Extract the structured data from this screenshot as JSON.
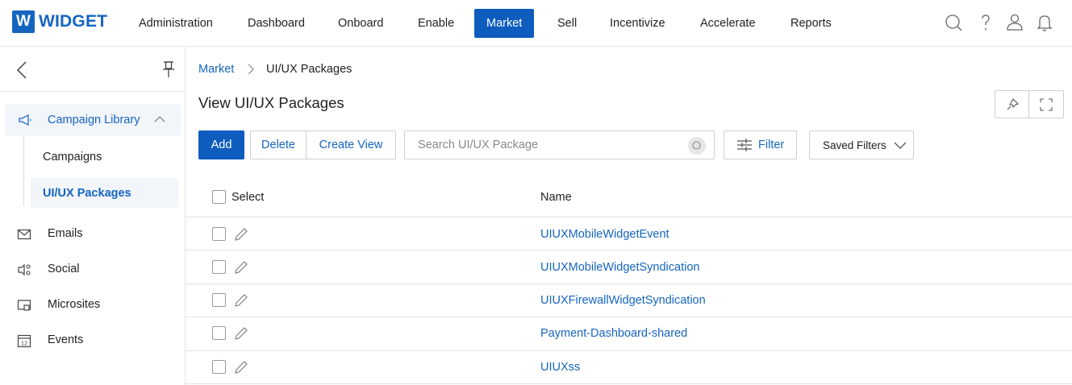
{
  "app": {
    "logo_letter": "W",
    "logo_name": "WIDGET",
    "brand_color": "#0d5cbe"
  },
  "nav": {
    "items": [
      "Administration",
      "Dashboard",
      "Onboard",
      "Enable",
      "Market",
      "Sell",
      "Incentivize",
      "Accelerate",
      "Reports"
    ],
    "active": "Market",
    "icons": [
      "search-icon",
      "help-icon",
      "user-icon",
      "bell-icon"
    ]
  },
  "sidebar": {
    "group": {
      "label": "Campaign Library",
      "expanded": true
    },
    "sub_items": [
      "Campaigns",
      "UI/UX Packages"
    ],
    "active_sub": "UI/UX Packages",
    "items": [
      {
        "label": "Emails",
        "icon": "mail-icon"
      },
      {
        "label": "Social",
        "icon": "social-icon"
      },
      {
        "label": "Microsites",
        "icon": "microsite-icon"
      },
      {
        "label": "Events",
        "icon": "calendar-icon",
        "icon_text": "12"
      }
    ]
  },
  "breadcrumb": {
    "parent": "Market",
    "current": "UI/UX Packages"
  },
  "page": {
    "title": "View UI/UX Packages"
  },
  "toolbar": {
    "add_label": "Add",
    "delete_label": "Delete",
    "create_view_label": "Create View",
    "search_placeholder": "Search UI/UX Package",
    "filter_label": "Filter",
    "saved_filters_label": "Saved Filters"
  },
  "table": {
    "columns": {
      "select": "Select",
      "name": "Name"
    },
    "rows": [
      {
        "name": "UIUXMobileWidgetEvent"
      },
      {
        "name": "UIUXMobileWidgetSyndication"
      },
      {
        "name": "UIUXFirewallWidgetSyndication"
      },
      {
        "name": "Payment-Dashboard-shared"
      },
      {
        "name": "UIUXss"
      }
    ]
  }
}
